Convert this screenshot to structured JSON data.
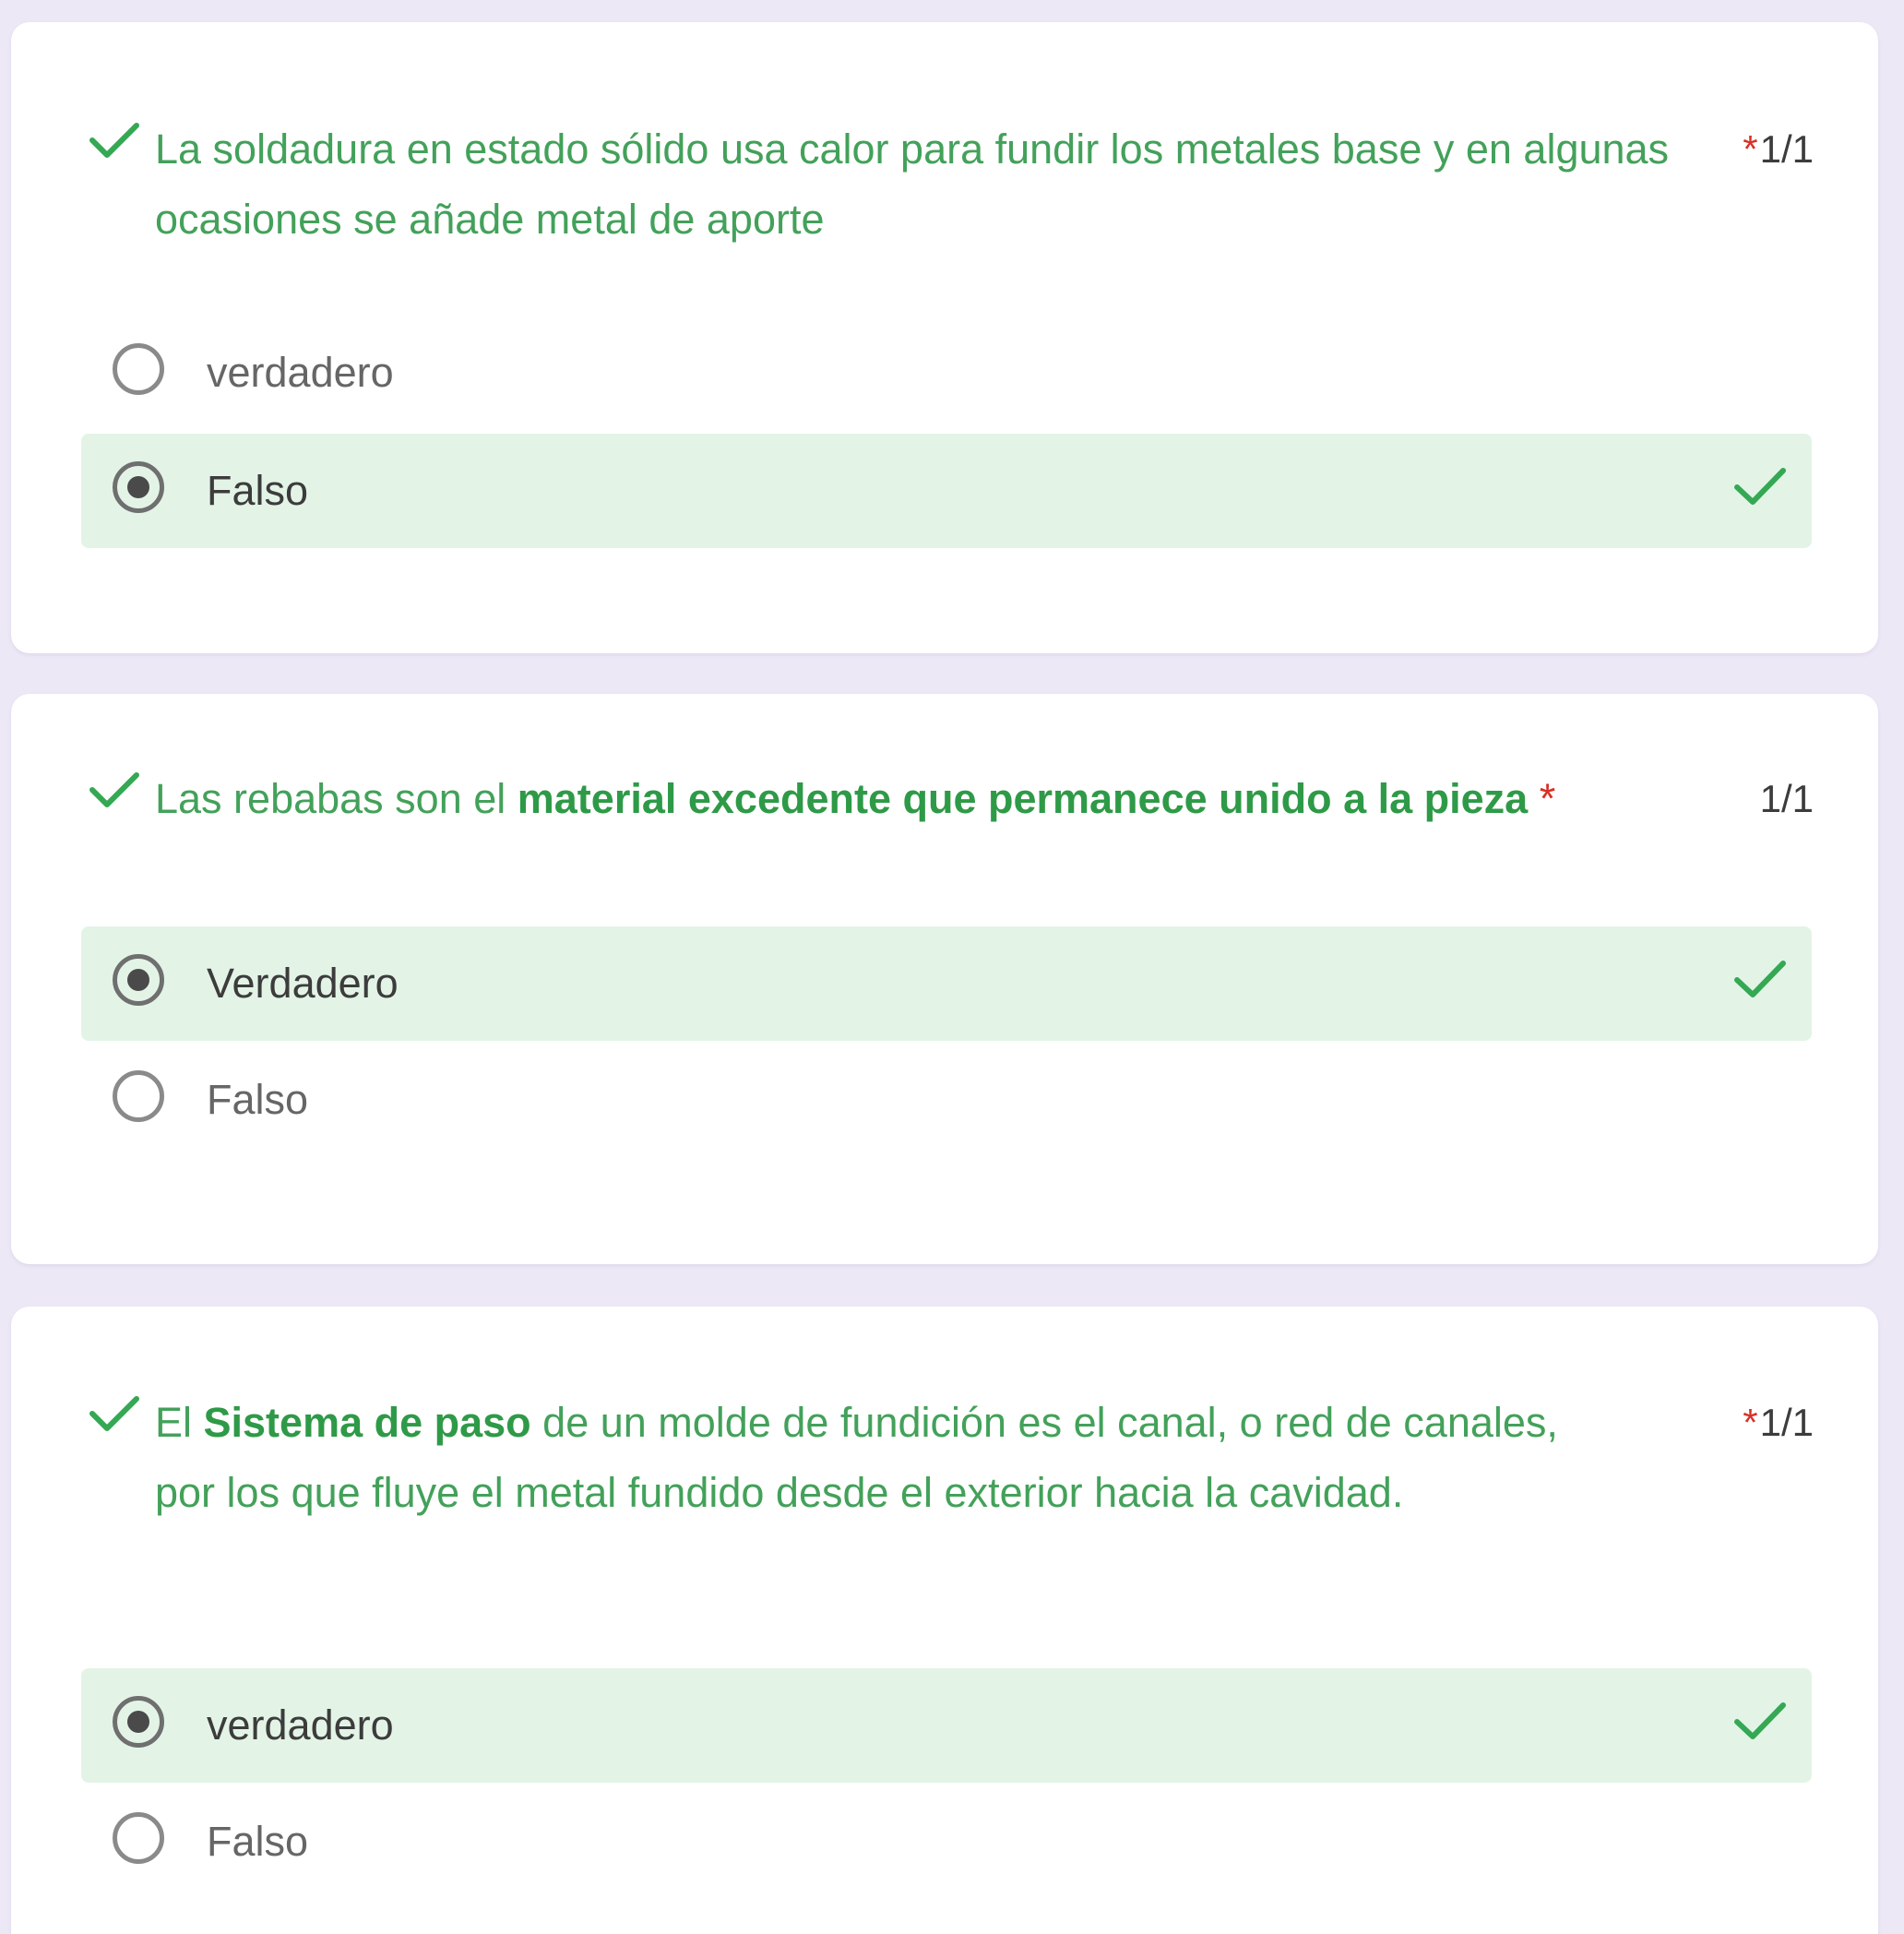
{
  "colors": {
    "page_background": "#ede8f6",
    "card_background": "#ffffff",
    "correct_green": "#34a853",
    "correct_row_background": "#e3f4e7",
    "required_star": "#d93025"
  },
  "questions": [
    {
      "text_before": "La soldadura en estado sólido usa calor para fundir los metales base y en algunas ocasiones se añade metal de aporte",
      "text_bold": "",
      "text_after": "",
      "required_marker": "*",
      "score": "1/1",
      "status_icon": "check-icon",
      "options": [
        {
          "label": "verdadero",
          "selected": false,
          "correct": false
        },
        {
          "label": "Falso",
          "selected": true,
          "correct": true
        }
      ]
    },
    {
      "text_before": "Las rebabas son el ",
      "text_bold": "material excedente que permanece unido a la pieza",
      "text_after": "",
      "required_marker": "*",
      "score": "1/1",
      "status_icon": "check-icon",
      "options": [
        {
          "label": "Verdadero",
          "selected": true,
          "correct": true
        },
        {
          "label": "Falso",
          "selected": false,
          "correct": false
        }
      ]
    },
    {
      "text_before": "El ",
      "text_bold": "Sistema de paso",
      "text_after": " de un molde de fundición es el canal, o red de canales, por los que fluye el metal fundido desde el exterior hacia la cavidad.",
      "required_marker": "*",
      "score": "1/1",
      "status_icon": "check-icon",
      "options": [
        {
          "label": "verdadero",
          "selected": true,
          "correct": true
        },
        {
          "label": "Falso",
          "selected": false,
          "correct": false
        }
      ]
    }
  ]
}
